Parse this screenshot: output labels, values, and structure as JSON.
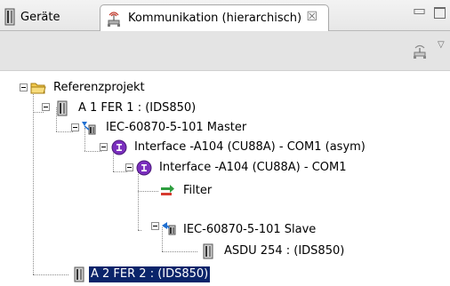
{
  "tabs": [
    {
      "label": "Geräte",
      "icon": "device-icon",
      "active": false
    },
    {
      "label": "Kommunikation (hierarchisch)",
      "icon": "network-icon",
      "active": true,
      "close_symbol": "☒"
    }
  ],
  "window_controls": {
    "minimize": "▭",
    "maximize": "maximize-icon"
  },
  "toolbar": {
    "button_icon": "network-filter-icon",
    "menu": "▽"
  },
  "tree": [
    {
      "label": "Referenzprojekt",
      "icon": "folder-icon",
      "expanded": true,
      "selected": false
    },
    {
      "label": "A 1 FER 1 : (IDS850)",
      "icon": "device-icon",
      "expanded": true,
      "selected": false
    },
    {
      "label": "IEC-60870-5-101 Master",
      "icon": "protocol-master-icon",
      "expanded": true,
      "selected": false
    },
    {
      "label": "Interface -A104 (CU88A) - COM1 (asym)",
      "icon": "interface-icon",
      "expanded": true,
      "selected": false
    },
    {
      "label": "Interface -A104 (CU88A) - COM1",
      "icon": "interface-icon",
      "expanded": true,
      "selected": false
    },
    {
      "label": "Filter",
      "icon": "filter-icon",
      "expanded": null,
      "selected": false
    },
    {
      "label": "IEC-60870-5-101 Slave",
      "icon": "protocol-slave-icon",
      "expanded": true,
      "selected": false
    },
    {
      "label": "ASDU 254 : (IDS850)",
      "icon": "device-icon",
      "expanded": null,
      "selected": false
    },
    {
      "label": "A 2 FER 2 : (IDS850)",
      "icon": "device-icon",
      "expanded": null,
      "selected": true
    }
  ],
  "colors": {
    "selection": "#0a246a",
    "interface_purple": "#7b2fbe",
    "folder_yellow": "#f2c94c"
  }
}
